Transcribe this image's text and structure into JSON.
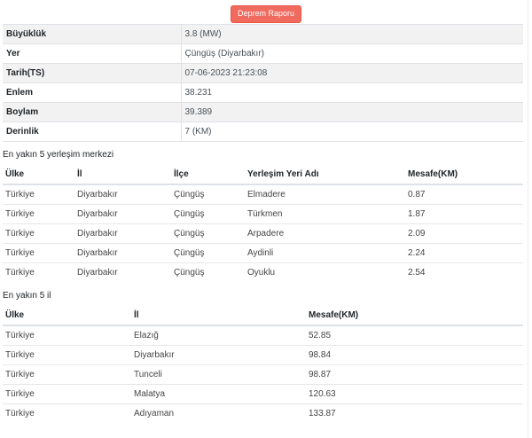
{
  "header": {
    "report_button": "Deprem Raporu"
  },
  "info": [
    {
      "label": "Büyüklük",
      "value": "3.8 (MW)"
    },
    {
      "label": "Yer",
      "value": "Çüngüş (Diyarbakır)"
    },
    {
      "label": "Tarih(TS)",
      "value": "07-06-2023 21:23:08"
    },
    {
      "label": "Enlem",
      "value": "38.231"
    },
    {
      "label": "Boylam",
      "value": "39.389"
    },
    {
      "label": "Derinlik",
      "value": "7 (KM)"
    }
  ],
  "settlements": {
    "title": "En yakın 5 yerleşim merkezi",
    "columns": [
      "Ülke",
      "İl",
      "İlçe",
      "Yerleşim Yeri Adı",
      "Mesafe(KM)"
    ],
    "rows": [
      [
        "Türkiye",
        "Diyarbakır",
        "Çüngüş",
        "Elmadere",
        "0.87"
      ],
      [
        "Türkiye",
        "Diyarbakır",
        "Çüngüş",
        "Türkmen",
        "1.87"
      ],
      [
        "Türkiye",
        "Diyarbakır",
        "Çüngüş",
        "Arpadere",
        "2.09"
      ],
      [
        "Türkiye",
        "Diyarbakır",
        "Çüngüş",
        "Aydinli",
        "2.24"
      ],
      [
        "Türkiye",
        "Diyarbakır",
        "Çüngüş",
        "Oyuklu",
        "2.54"
      ]
    ]
  },
  "provinces": {
    "title": "En yakın 5 il",
    "columns": [
      "Ülke",
      "İl",
      "Mesafe(KM)"
    ],
    "rows": [
      [
        "Türkiye",
        "Elazığ",
        "52.85"
      ],
      [
        "Türkiye",
        "Diyarbakır",
        "98.84"
      ],
      [
        "Türkiye",
        "Tunceli",
        "98.87"
      ],
      [
        "Türkiye",
        "Malatya",
        "120.63"
      ],
      [
        "Türkiye",
        "Adıyaman",
        "133.87"
      ]
    ]
  }
}
